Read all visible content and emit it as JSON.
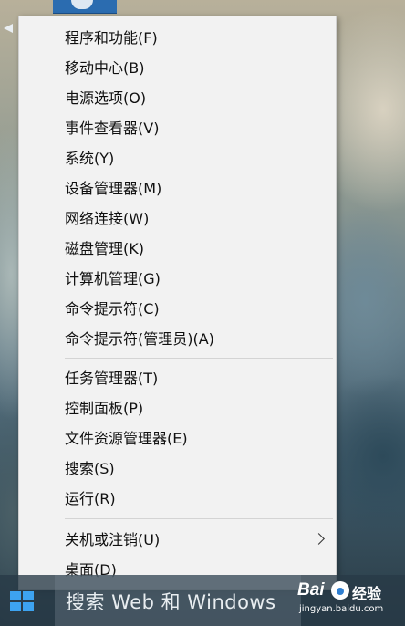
{
  "colors": {
    "menu_background": "#f2f2f2",
    "menu_text": "#111111",
    "separator": "#d4d4d4",
    "taskbar": "#283a46",
    "windows_logo": "#3da3f0"
  },
  "menu": {
    "groups": [
      {
        "items": [
          {
            "label": "程序和功能(F)"
          },
          {
            "label": "移动中心(B)"
          },
          {
            "label": "电源选项(O)"
          },
          {
            "label": "事件查看器(V)"
          },
          {
            "label": "系统(Y)"
          },
          {
            "label": "设备管理器(M)"
          },
          {
            "label": "网络连接(W)"
          },
          {
            "label": "磁盘管理(K)"
          },
          {
            "label": "计算机管理(G)"
          },
          {
            "label": "命令提示符(C)"
          },
          {
            "label": "命令提示符(管理员)(A)"
          }
        ]
      },
      {
        "items": [
          {
            "label": "任务管理器(T)"
          },
          {
            "label": "控制面板(P)"
          },
          {
            "label": "文件资源管理器(E)"
          },
          {
            "label": "搜索(S)"
          },
          {
            "label": "运行(R)"
          }
        ]
      },
      {
        "items": [
          {
            "label": "关机或注销(U)",
            "has_submenu": true
          },
          {
            "label": "桌面(D)"
          }
        ]
      }
    ]
  },
  "taskbar": {
    "start_icon": "windows-logo-icon",
    "search_placeholder": "搜索 Web 和 Windows"
  },
  "watermark": {
    "logo_text": "Bai",
    "paw_icon": "baidu-paw-icon",
    "label": "经验",
    "url": "jingyan.baidu.com"
  }
}
